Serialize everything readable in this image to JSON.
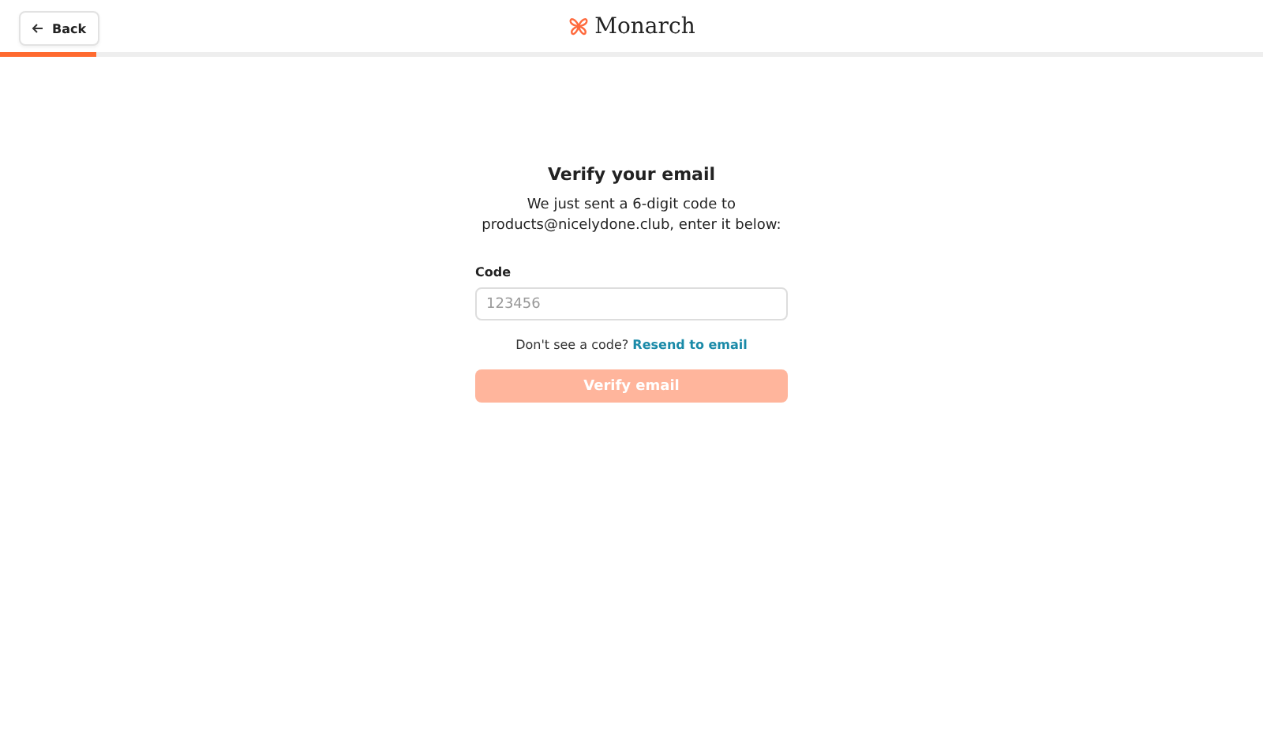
{
  "header": {
    "back_button": "Back",
    "logo": "Monarch",
    "progress": {
      "level": 0.076
    }
  },
  "form": {
    "title": "Verify your email",
    "description": "We just sent a 6-digit code to products@nicelydone.club, enter it below:",
    "code_field": {
      "label": "Code",
      "placeholder": "123456"
    },
    "resend": {
      "prompt": "Don't see a code?",
      "link": "Resend to email"
    },
    "submit": {
      "label": "Verify email",
      "disabled": true
    }
  }
}
